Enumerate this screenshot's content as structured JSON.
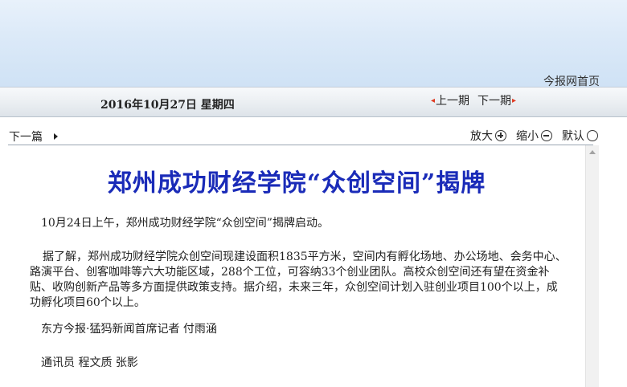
{
  "header": {
    "home_link": "今报网首页"
  },
  "datebar": {
    "date": "2016年10月27日  星期四",
    "prev_issue": "上一期",
    "next_issue": "下一期"
  },
  "toolbar": {
    "next_article": "下一篇",
    "zoom_in": "放大",
    "zoom_out": "缩小",
    "default": "默认"
  },
  "article": {
    "title": "郑州成功财经学院“众创空间”揭牌",
    "paragraphs": [
      "10月24日上午，郑州成功财经学院“众创空间”揭牌启动。",
      "据了解，郑州成功财经学院众创空间现建设面积1835平方米，空间内有孵化场地、办公场地、会务中心、路演平台、创客咖啡等六大功能区域，288个工位，可容纳33个创业团队。高校众创空间还有望在资金补贴、收购创新产品等多方面提供政策支持。据介绍，未来三年，众创空间计划入驻创业项目100个以上，成功孵化项目60个以上。",
      "东方今报·猛犸新闻首席记者 付雨涵",
      "通讯员 程文质 张影"
    ]
  },
  "colors": {
    "title_blue": "#1a2bb8",
    "nav_arrow": "#e03a22"
  }
}
